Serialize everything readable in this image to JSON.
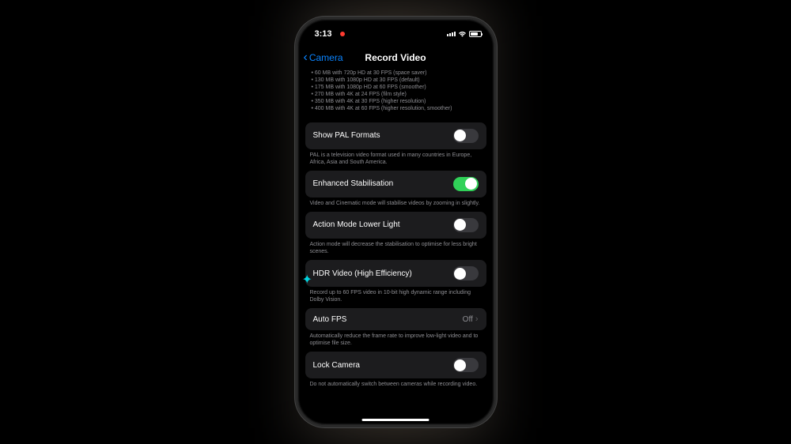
{
  "statusBar": {
    "time": "3:13"
  },
  "navBar": {
    "backLabel": "Camera",
    "title": "Record Video"
  },
  "sizeList": [
    "• 60 MB with 720p HD at 30 FPS (space saver)",
    "• 130 MB with 1080p HD at 30 FPS (default)",
    "• 175 MB with 1080p HD at 60 FPS (smoother)",
    "• 270 MB with 4K at 24 FPS (film style)",
    "• 350 MB with 4K at 30 FPS (higher resolution)",
    "• 400 MB with 4K at 60 FPS (higher resolution, smoother)"
  ],
  "settings": {
    "pal": {
      "label": "Show PAL Formats",
      "on": false,
      "footer": "PAL is a television video format used in many countries in Europe, Africa, Asia and South America."
    },
    "stabilisation": {
      "label": "Enhanced Stabilisation",
      "on": true,
      "footer": "Video and Cinematic mode will stabilise videos by zooming in slightly."
    },
    "actionMode": {
      "label": "Action Mode Lower Light",
      "on": false,
      "footer": "Action mode will decrease the stabilisation to optimise for less bright scenes."
    },
    "hdr": {
      "label": "HDR Video (High Efficiency)",
      "on": false,
      "footer": "Record up to 60 FPS video in 10-bit high dynamic range including Dolby Vision."
    },
    "autoFps": {
      "label": "Auto FPS",
      "value": "Off",
      "footer": "Automatically reduce the frame rate to improve low-light video and to optimise file size."
    },
    "lockCamera": {
      "label": "Lock Camera",
      "on": false,
      "footer": "Do not automatically switch between cameras while recording video."
    }
  }
}
